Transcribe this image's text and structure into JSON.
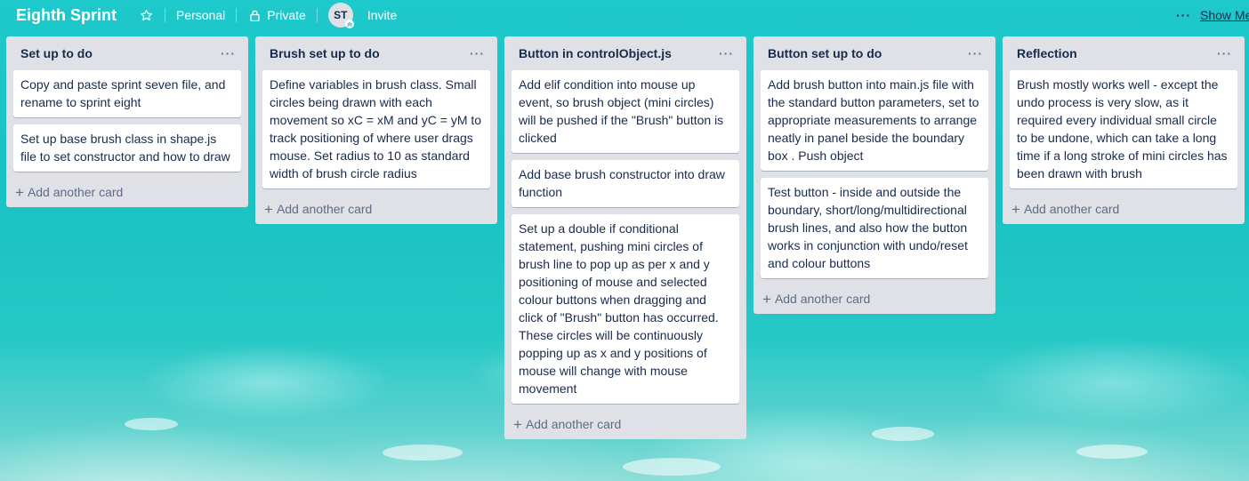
{
  "board": {
    "title": "Eighth Sprint",
    "team_label": "Personal",
    "visibility_label": "Private",
    "member_initials": "ST",
    "invite_label": "Invite",
    "show_menu_dots": "···",
    "show_menu_label": "Show Me"
  },
  "lists": [
    {
      "title": "Set up to do",
      "menu": "···",
      "add_card_label": "Add another card",
      "cards": [
        "Copy and paste sprint seven file, and rename to sprint eight",
        "Set up base brush class in shape.js file to set constructor and how to draw"
      ]
    },
    {
      "title": "Brush set up to do",
      "menu": "···",
      "add_card_label": "Add another card",
      "cards": [
        "Define variables in brush class. Small circles being drawn with each movement so xC = xM and yC = yM to track positioning of where user drags mouse. Set radius to 10 as standard width of brush circle radius"
      ]
    },
    {
      "title": "Button in controlObject.js",
      "menu": "···",
      "add_card_label": "Add another card",
      "cards": [
        "Add elif condition into mouse up event, so brush object (mini circles) will be pushed if the \"Brush\" button is clicked",
        "Add base brush constructor into draw function",
        "Set up a double if conditional statement, pushing mini circles of brush line to pop up as per x and y positioning of mouse and selected colour buttons when dragging and click of \"Brush\" button has occurred. These circles will be continuously popping up as x and y positions of mouse will change with mouse movement"
      ]
    },
    {
      "title": "Button set up to do",
      "menu": "···",
      "add_card_label": "Add another card",
      "cards": [
        "Add brush button into main.js file with the standard button parameters, set to appropriate measurements to arrange neatly in panel beside the boundary box . Push object",
        "Test button - inside and outside the boundary, short/long/multidirectional brush lines, and also how the button works in conjunction with undo/reset and colour buttons"
      ]
    },
    {
      "title": "Reflection",
      "menu": "···",
      "add_card_label": "Add another card",
      "cards": [
        "Brush mostly works well - except the undo process is very slow, as it required every individual small circle to be undone, which can take a long time if a long stroke of mini circles has been drawn with brush"
      ]
    }
  ],
  "colors": {
    "list_bg": "#dfe1e6",
    "card_bg": "#ffffff",
    "text": "#172b4d",
    "muted": "#5e6c84",
    "board_bg": "#1fc6c8"
  }
}
